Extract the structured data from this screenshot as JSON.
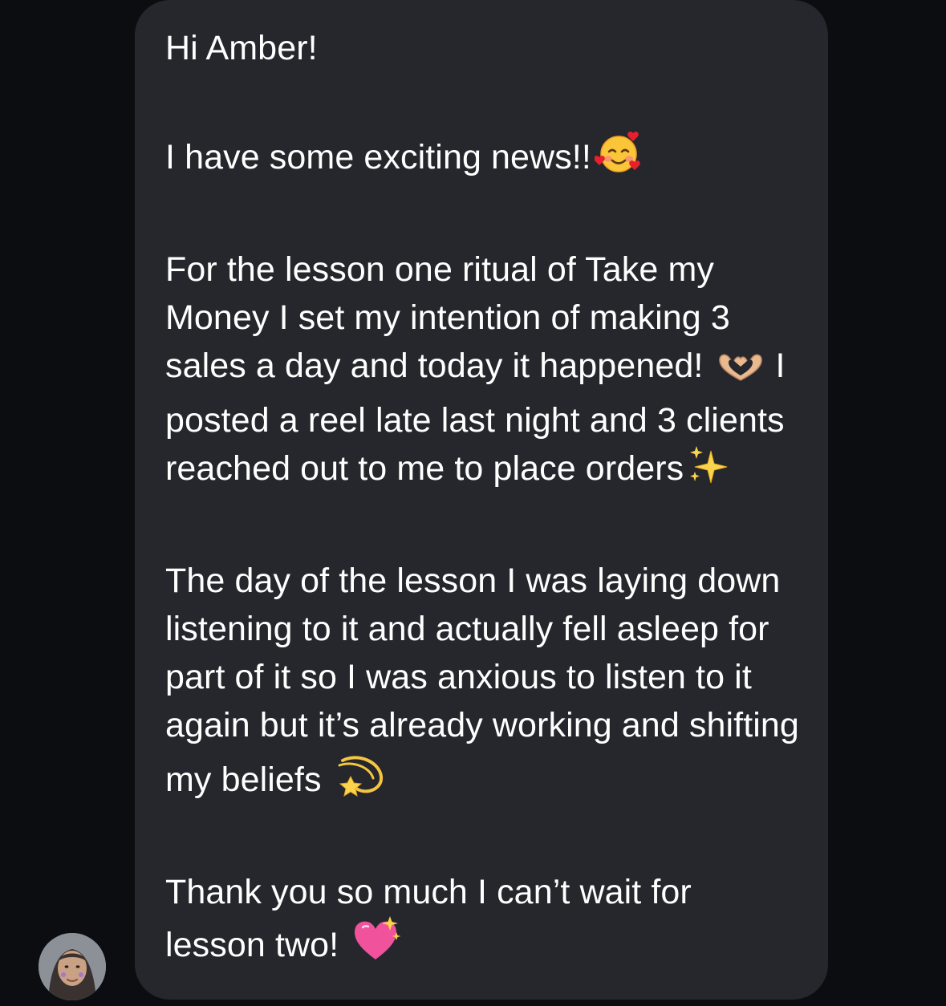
{
  "message": {
    "greeting": "Hi Amber!",
    "news": "I have some exciting news!!",
    "paragraph1_part1": "For the lesson one ritual of Take my Money I set my intention of making 3 sales a day and today it happened!",
    "paragraph1_part2": "I posted a reel late last night and 3 clients reached out to me to place orders",
    "paragraph2": "The day of the lesson I was laying down listening to it and actually fell asleep for part of it so I was anxious to listen to it again but it’s already working and shifting my beliefs",
    "paragraph3": "Thank you so much I can’t wait for lesson two!"
  },
  "icons": {
    "news_emoji": "smiling-face-with-hearts-icon",
    "heart_hands_emoji": "heart-hands-icon",
    "sparkles_emoji": "sparkles-icon",
    "dizzy_emoji": "dizzy-star-icon",
    "sparkling_heart_emoji": "sparkling-heart-icon"
  },
  "colors": {
    "background": "#0b0d10",
    "bubble": "#25272c",
    "text": "#ffffff"
  }
}
